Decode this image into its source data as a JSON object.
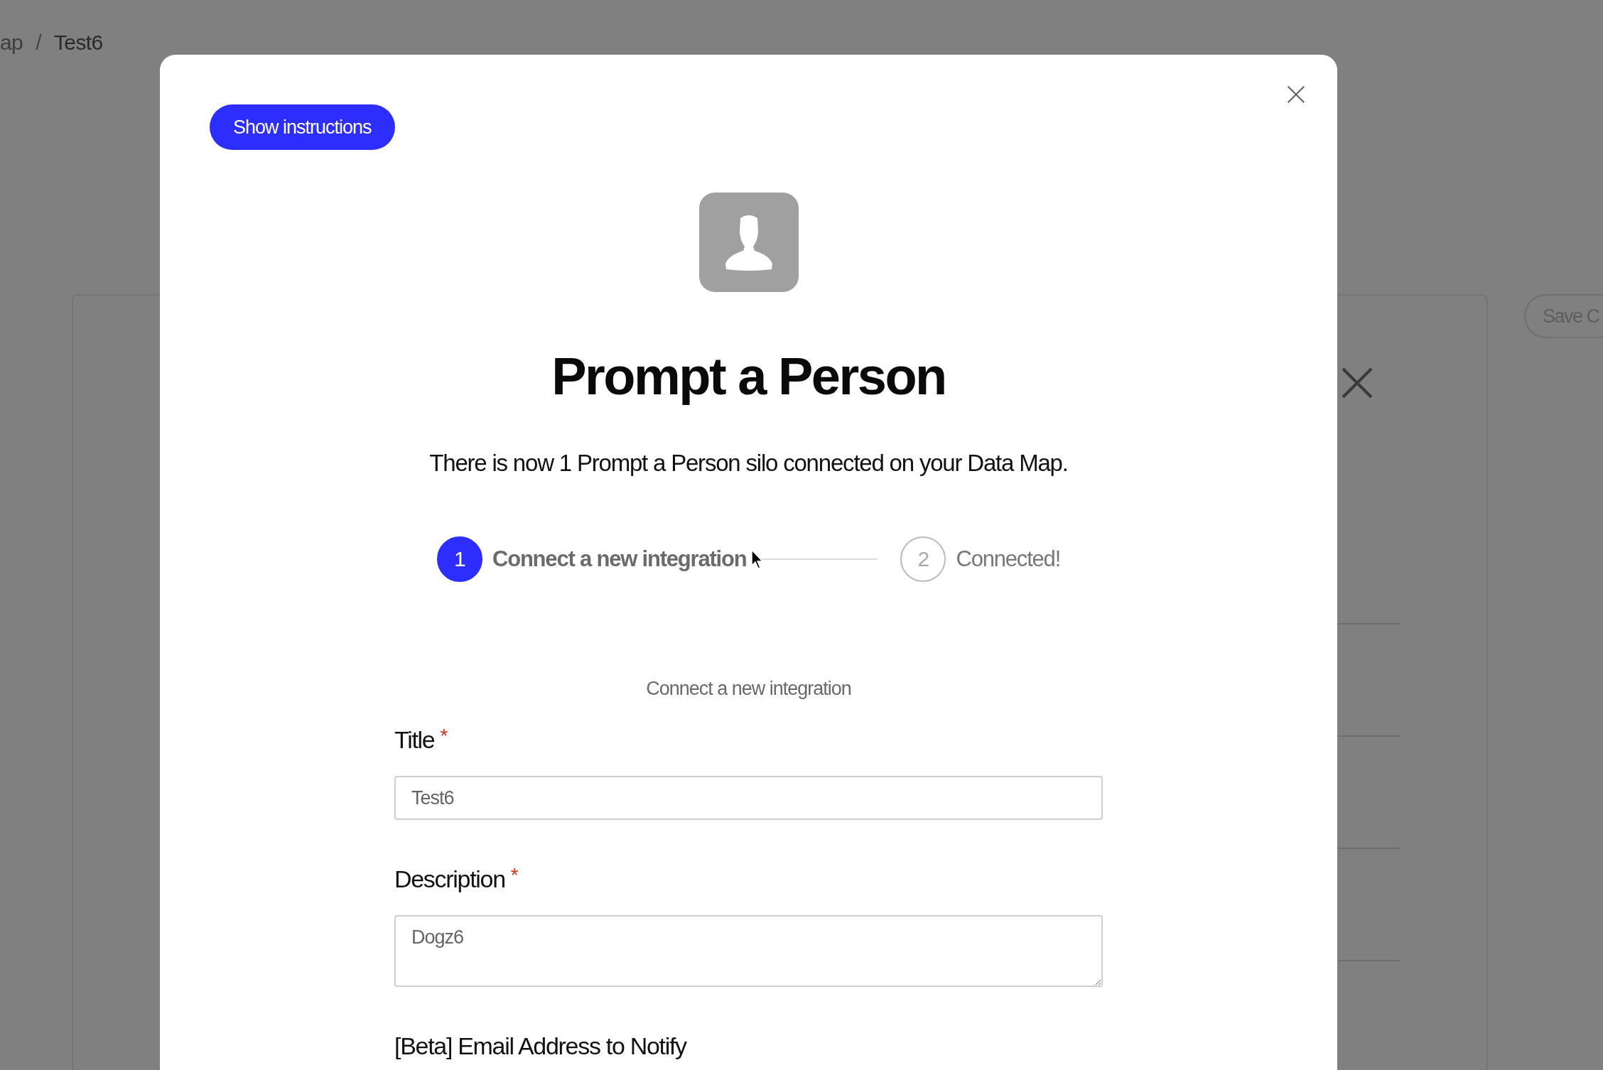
{
  "background": {
    "breadcrumb": {
      "items": [
        "ap",
        "Test6"
      ],
      "separator": "/"
    },
    "save_button": "Save C"
  },
  "modal": {
    "show_instructions_button": "Show instructions",
    "title": "Prompt a Person",
    "subtitle": "There is now 1 Prompt a Person silo connected on your Data Map.",
    "steps": [
      {
        "number": "1",
        "label": "Connect a new integration",
        "selected": true
      },
      {
        "number": "2",
        "label": "Connected!",
        "selected": false
      }
    ],
    "section_heading": "Connect a new integration",
    "fields": [
      {
        "label": "Title",
        "required_mark": "*",
        "kind": "input",
        "value": "Test6"
      },
      {
        "label": "Description",
        "required_mark": "*",
        "kind": "textarea",
        "value": "Dogz6"
      },
      {
        "label": "[Beta] Email Address to Notify"
      }
    ]
  }
}
